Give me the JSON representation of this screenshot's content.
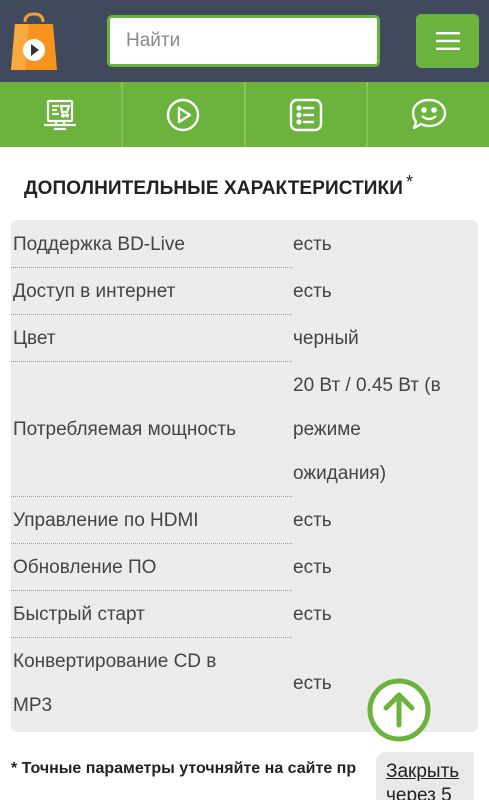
{
  "header": {
    "search_placeholder": "Найти",
    "brand_color": "#6cb33e",
    "bar_color": "#414a5c"
  },
  "iconbar": {
    "items": [
      {
        "icon": "catalog-screen-icon"
      },
      {
        "icon": "play-circle-icon"
      },
      {
        "icon": "list-icon"
      },
      {
        "icon": "chat-smile-icon"
      }
    ]
  },
  "section": {
    "title": "ДОПОЛНИТЕЛЬНЫЕ ХАРАКТЕРИСТИКИ",
    "title_mark": "*"
  },
  "specs": [
    {
      "label": "Поддержка BD-Live",
      "value": "есть"
    },
    {
      "label": "Доступ в интернет",
      "value": "есть"
    },
    {
      "label": "Цвет",
      "value": "черный"
    },
    {
      "label": "Потребляемая мощность",
      "value_lines": [
        "20 Вт / 0.45 Вт (в",
        "режиме",
        "ожидания)"
      ]
    },
    {
      "label": "Управление по HDMI",
      "value": "есть"
    },
    {
      "label": "Обновление ПО",
      "value": "есть"
    },
    {
      "label": "Быстрый старт",
      "value": "есть"
    },
    {
      "label_lines": [
        "Конвертирование CD в",
        "MP3"
      ],
      "value": "есть"
    }
  ],
  "footnote": "* Точные параметры уточняйте на сайте пр",
  "close_popup": {
    "line1": "Закрыть",
    "line2": "через 5"
  }
}
